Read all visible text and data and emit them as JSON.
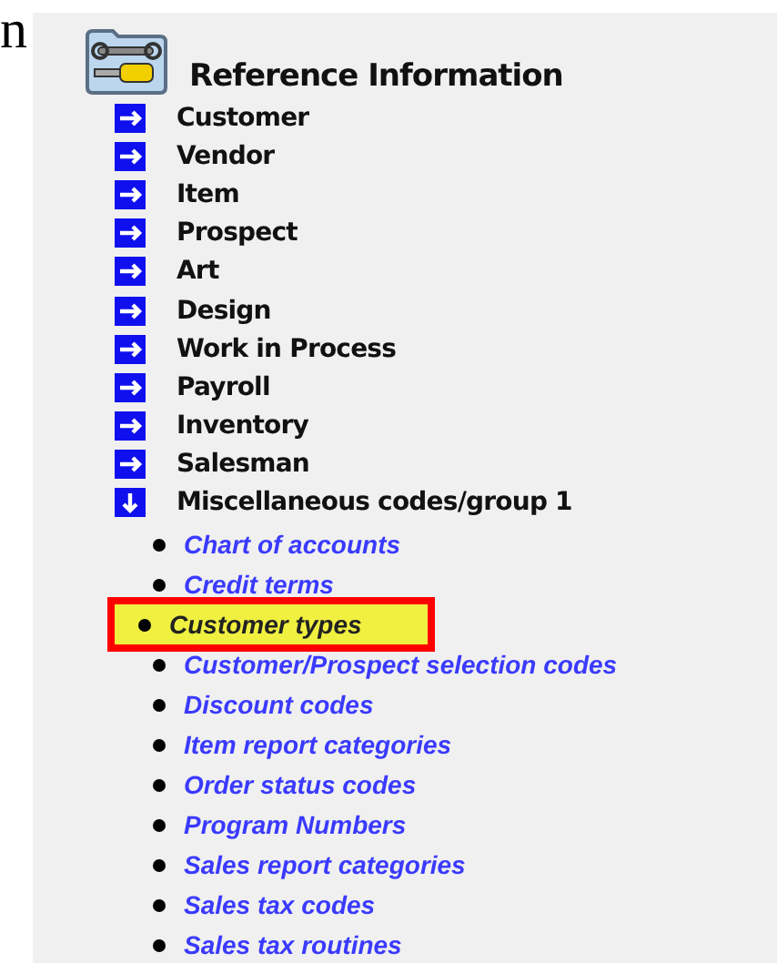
{
  "edge_text": "n",
  "section": {
    "title": "Reference Information",
    "items": [
      {
        "label": "Customer",
        "expanded": false
      },
      {
        "label": "Vendor",
        "expanded": false
      },
      {
        "label": "Item",
        "expanded": false
      },
      {
        "label": "Prospect",
        "expanded": false
      },
      {
        "label": "Art",
        "expanded": false
      },
      {
        "label": "Design",
        "expanded": false
      },
      {
        "label": "Work in Process",
        "expanded": false
      },
      {
        "label": "Payroll",
        "expanded": false
      },
      {
        "label": "Inventory",
        "expanded": false
      },
      {
        "label": "Salesman",
        "expanded": false
      },
      {
        "label": "Miscellaneous codes/group 1",
        "expanded": true,
        "children": [
          {
            "label": "Chart of accounts",
            "selected": false
          },
          {
            "label": "Credit terms",
            "selected": false
          },
          {
            "label": "Customer types",
            "selected": true
          },
          {
            "label": "Customer/Prospect selection codes",
            "selected": false
          },
          {
            "label": "Discount codes",
            "selected": false
          },
          {
            "label": "Item report categories",
            "selected": false
          },
          {
            "label": "Order status codes",
            "selected": false
          },
          {
            "label": "Program Numbers",
            "selected": false
          },
          {
            "label": "Sales report categories",
            "selected": false
          },
          {
            "label": "Sales tax codes",
            "selected": false
          },
          {
            "label": "Sales tax routines",
            "selected": false
          }
        ]
      }
    ]
  }
}
